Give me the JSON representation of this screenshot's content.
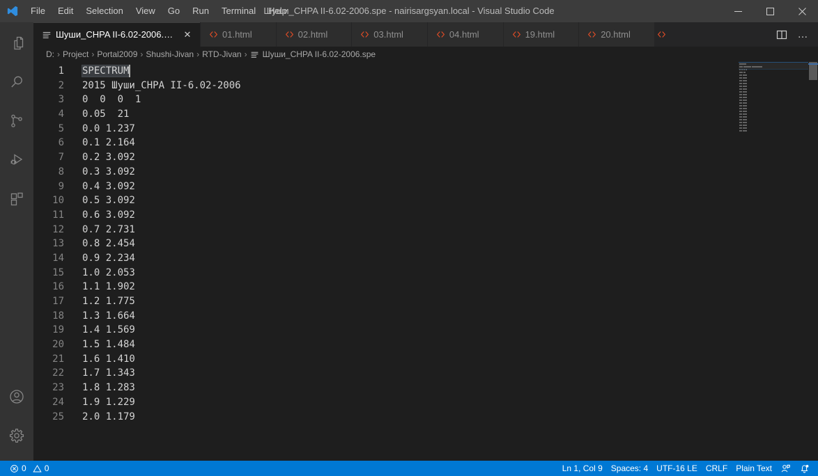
{
  "window": {
    "title": "Шуши_CHPA II-6.02-2006.spe - nairisargsyan.local - Visual Studio Code",
    "controls": {
      "minimize": "minimize-icon",
      "maximize": "maximize-icon",
      "close": "close-icon"
    }
  },
  "menu": {
    "items": [
      {
        "label": "File"
      },
      {
        "label": "Edit"
      },
      {
        "label": "Selection"
      },
      {
        "label": "View"
      },
      {
        "label": "Go"
      },
      {
        "label": "Run"
      },
      {
        "label": "Terminal"
      },
      {
        "label": "Help"
      }
    ]
  },
  "activitybar": {
    "top": [
      {
        "name": "explorer",
        "icon": "files-icon",
        "active": false
      },
      {
        "name": "search",
        "icon": "search-icon",
        "active": false
      },
      {
        "name": "source-control",
        "icon": "source-control-icon",
        "active": false
      },
      {
        "name": "run-and-debug",
        "icon": "run-debug-icon",
        "active": false
      },
      {
        "name": "extensions",
        "icon": "extensions-icon",
        "active": false
      }
    ],
    "bottom": [
      {
        "name": "accounts",
        "icon": "account-icon"
      },
      {
        "name": "manage",
        "icon": "gear-icon"
      }
    ]
  },
  "tabs": [
    {
      "label": "Шуши_CHPA II-6.02-2006.spe",
      "icon": "plaintext-icon",
      "active": true,
      "close": "✕"
    },
    {
      "label": "01.html",
      "icon": "html-icon",
      "active": false,
      "close": "✕"
    },
    {
      "label": "02.html",
      "icon": "html-icon",
      "active": false,
      "close": "✕"
    },
    {
      "label": "03.html",
      "icon": "html-icon",
      "active": false,
      "close": "✕"
    },
    {
      "label": "04.html",
      "icon": "html-icon",
      "active": false,
      "close": "✕"
    },
    {
      "label": "19.html",
      "icon": "html-icon",
      "active": false,
      "close": "✕"
    },
    {
      "label": "20.html",
      "icon": "html-icon",
      "active": false,
      "close": "✕"
    }
  ],
  "tab_actions": {
    "split_editor": "split-editor-icon",
    "more_actions": "…"
  },
  "breadcrumbs": {
    "separator": "›",
    "items": [
      {
        "label": "D:"
      },
      {
        "label": "Project"
      },
      {
        "label": "Portal2009"
      },
      {
        "label": "Shushi-Jivan"
      },
      {
        "label": "RTD-Jivan"
      },
      {
        "label": "Шуши_CHPA II-6.02-2006.spe",
        "icon": "plaintext-icon"
      }
    ]
  },
  "editor": {
    "selected_word": "SPECTRUM",
    "lines": [
      {
        "n": "1",
        "text": "SPECTRUM"
      },
      {
        "n": "2",
        "text": "2015 Шуши_CHPA II-6.02-2006"
      },
      {
        "n": "3",
        "text": "0  0  0  1"
      },
      {
        "n": "4",
        "text": "0.05  21"
      },
      {
        "n": "5",
        "text": "0.0 1.237"
      },
      {
        "n": "6",
        "text": "0.1 2.164"
      },
      {
        "n": "7",
        "text": "0.2 3.092"
      },
      {
        "n": "8",
        "text": "0.3 3.092"
      },
      {
        "n": "9",
        "text": "0.4 3.092"
      },
      {
        "n": "10",
        "text": "0.5 3.092"
      },
      {
        "n": "11",
        "text": "0.6 3.092"
      },
      {
        "n": "12",
        "text": "0.7 2.731"
      },
      {
        "n": "13",
        "text": "0.8 2.454"
      },
      {
        "n": "14",
        "text": "0.9 2.234"
      },
      {
        "n": "15",
        "text": "1.0 2.053"
      },
      {
        "n": "16",
        "text": "1.1 1.902"
      },
      {
        "n": "17",
        "text": "1.2 1.775"
      },
      {
        "n": "18",
        "text": "1.3 1.664"
      },
      {
        "n": "19",
        "text": "1.4 1.569"
      },
      {
        "n": "20",
        "text": "1.5 1.484"
      },
      {
        "n": "21",
        "text": "1.6 1.410"
      },
      {
        "n": "22",
        "text": "1.7 1.343"
      },
      {
        "n": "23",
        "text": "1.8 1.283"
      },
      {
        "n": "24",
        "text": "1.9 1.229"
      },
      {
        "n": "25",
        "text": "2.0 1.179"
      }
    ]
  },
  "statusbar": {
    "problems": {
      "errors": "0",
      "warnings": "0"
    },
    "cursor_position": "Ln 1, Col 9",
    "indentation": "Spaces: 4",
    "encoding": "UTF-16 LE",
    "eol": "CRLF",
    "language": "Plain Text",
    "feedback_icon": "feedback-icon",
    "notifications_icon": "bell-icon"
  },
  "colors": {
    "titlebar_bg": "#3c3c3c",
    "activitybar_bg": "#333333",
    "tabbar_bg": "#252526",
    "editor_bg": "#1e1e1e",
    "statusbar_bg": "#0078d4",
    "accent_blue": "#0078d4",
    "html_icon": "#e44d26",
    "text": "#d4d4d4"
  }
}
